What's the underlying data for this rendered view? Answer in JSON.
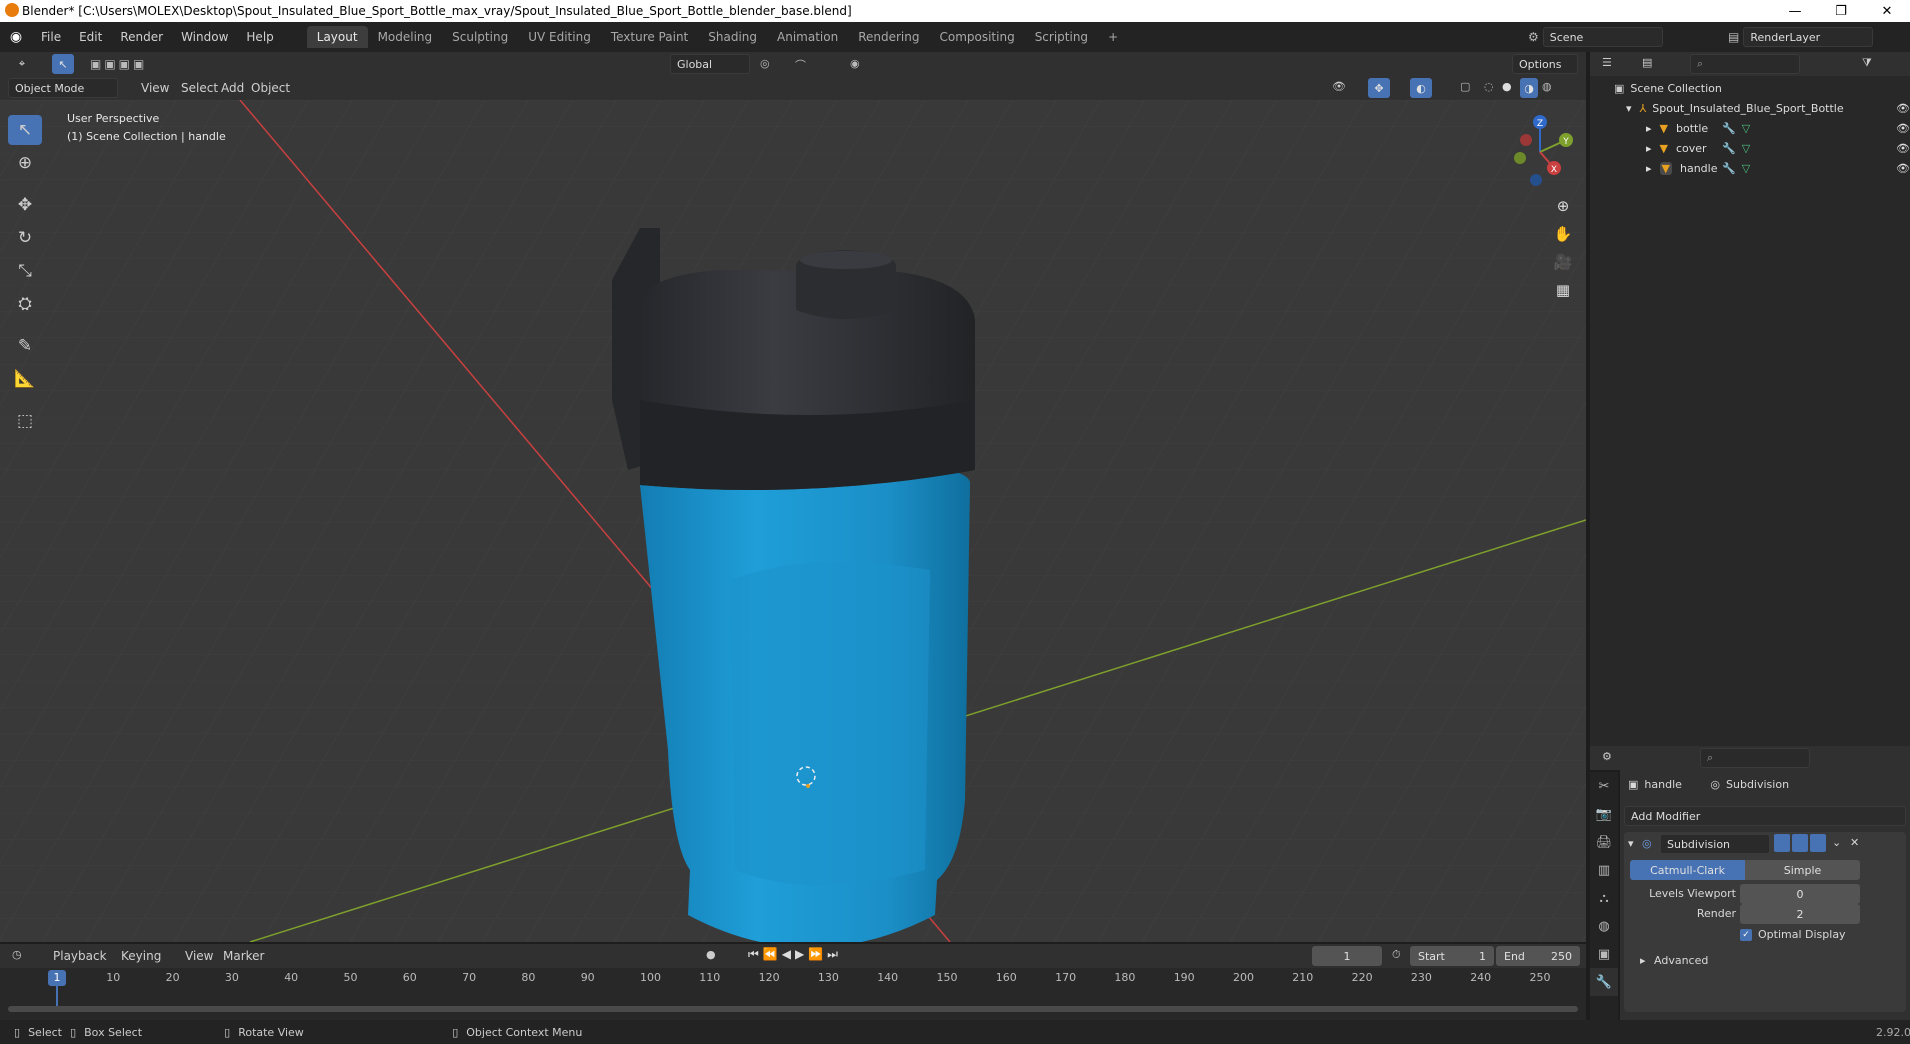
{
  "title_bar": {
    "text": "Blender* [C:\\Users\\MOLEX\\Desktop\\Spout_Insulated_Blue_Sport_Bottle_max_vray/Spout_Insulated_Blue_Sport_Bottle_blender_base.blend]",
    "minimize": "—",
    "maximize": "❐",
    "close": "✕"
  },
  "menu": {
    "items": [
      "File",
      "Edit",
      "Render",
      "Window",
      "Help"
    ],
    "workspaces": [
      "Layout",
      "Modeling",
      "Sculpting",
      "UV Editing",
      "Texture Paint",
      "Shading",
      "Animation",
      "Rendering",
      "Compositing",
      "Scripting"
    ],
    "active_workspace": "Layout",
    "add_workspace": "+",
    "scene_label": "Scene",
    "render_layer": "RenderLayer"
  },
  "viewport_header": {
    "mode": "Object Mode",
    "menus": [
      "View",
      "Select",
      "Add",
      "Object"
    ],
    "transform_orientation": "Global",
    "options": "Options"
  },
  "viewport": {
    "perspective": "User Perspective",
    "collection_info": "(1) Scene Collection | handle",
    "gizmo_axes": [
      "X",
      "Y",
      "Z"
    ]
  },
  "outliner": {
    "root": "Scene Collection",
    "collection": "Spout_Insulated_Blue_Sport_Bottle",
    "objects": [
      "bottle",
      "cover",
      "handle"
    ]
  },
  "properties": {
    "object": "handle",
    "modifier_breadcrumb": "Subdivision",
    "add_modifier": "Add Modifier",
    "modifier_name": "Subdivision",
    "subdiv_types": [
      "Catmull-Clark",
      "Simple"
    ],
    "active_type": "Catmull-Clark",
    "levels_viewport_label": "Levels Viewport",
    "levels_viewport_value": "0",
    "render_label": "Render",
    "render_value": "2",
    "optimal_display": "Optimal Display",
    "advanced": "Advanced",
    "version": "2.92.0"
  },
  "timeline": {
    "menus": [
      "Playback",
      "Keying",
      "View",
      "Marker"
    ],
    "current_frame": "1",
    "start_label": "Start",
    "start_value": "1",
    "end_label": "End",
    "end_value": "250",
    "ruler": [
      "10",
      "20",
      "30",
      "40",
      "50",
      "60",
      "70",
      "80",
      "90",
      "100",
      "110",
      "120",
      "130",
      "140",
      "150",
      "160",
      "170",
      "180",
      "190",
      "200",
      "210",
      "220",
      "230",
      "240",
      "250"
    ],
    "playhead": "1"
  },
  "statusbar": {
    "select": "Select",
    "box_select": "Box Select",
    "rotate_view": "Rotate View",
    "context_menu": "Object Context Menu"
  },
  "colors": {
    "accent": "#4772b3",
    "bottle_body": "#1f9ed8",
    "bottle_cap": "#2e2f33",
    "x_axis": "#c8403f",
    "y_axis": "#7ea02c"
  },
  "icons": [
    "blender-logo",
    "search-icon",
    "filter-icon",
    "eye-icon",
    "wrench-icon",
    "mesh-icon",
    "move-icon",
    "rotate-icon",
    "scale-icon",
    "zoom-icon",
    "hand-icon",
    "camera-icon",
    "grid-icon"
  ]
}
